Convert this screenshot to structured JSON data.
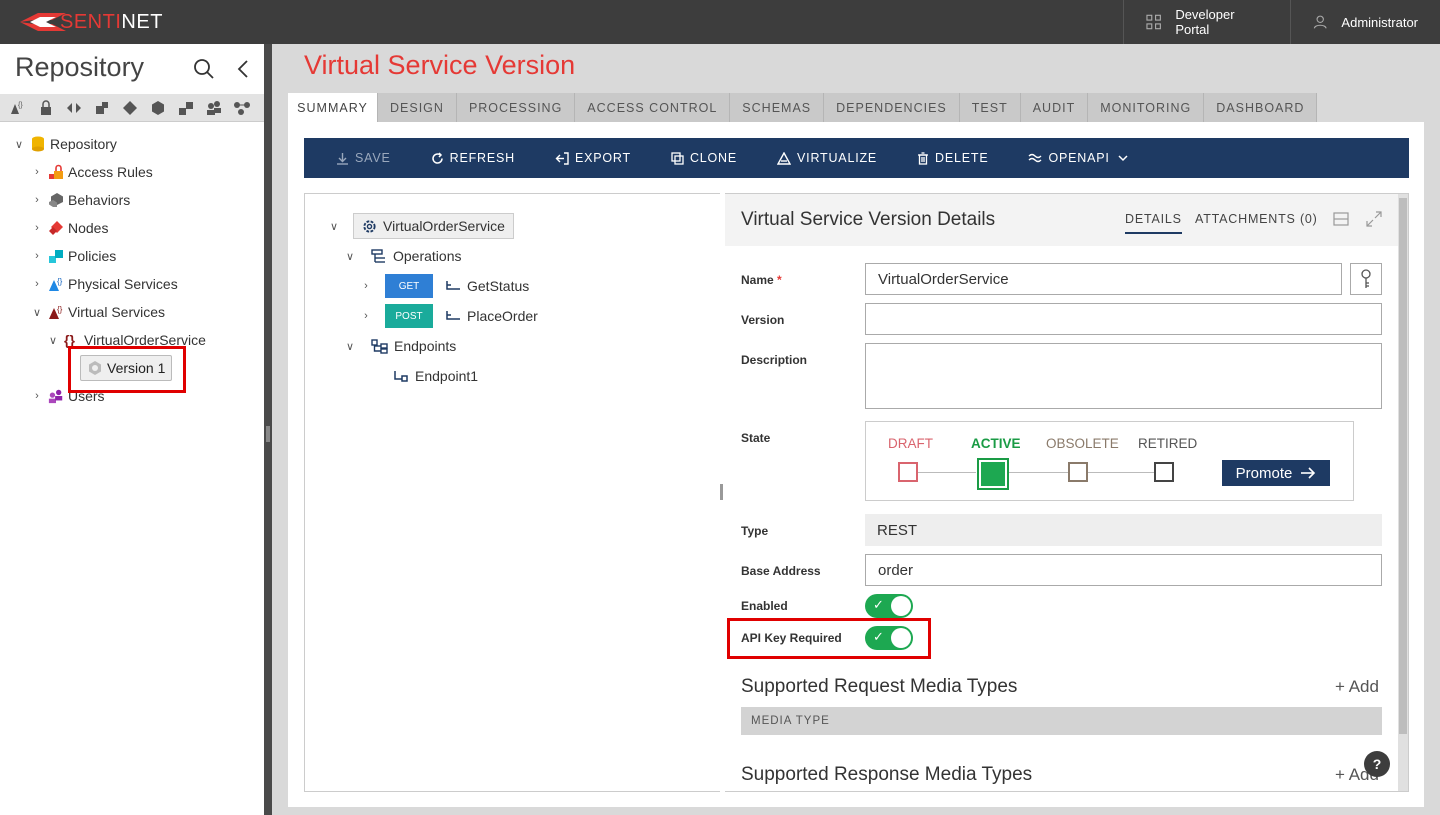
{
  "app": {
    "logo_prefix": "SENTI",
    "logo_suffix": "NET",
    "developer_portal": "Developer Portal",
    "user": "Administrator"
  },
  "sidebar": {
    "title": "Repository",
    "tree": {
      "root": "Repository",
      "items": [
        "Access Rules",
        "Behaviors",
        "Nodes",
        "Policies",
        "Physical Services",
        "Virtual Services"
      ],
      "service": "VirtualOrderService",
      "version": "Version 1",
      "users": "Users"
    }
  },
  "main": {
    "title": "Virtual Service Version",
    "tabs": [
      "SUMMARY",
      "DESIGN",
      "PROCESSING",
      "ACCESS CONTROL",
      "SCHEMAS",
      "DEPENDENCIES",
      "TEST",
      "AUDIT",
      "MONITORING",
      "DASHBOARD"
    ],
    "active_tab": "SUMMARY",
    "toolbar": {
      "save": "SAVE",
      "refresh": "REFRESH",
      "export": "EXPORT",
      "clone": "CLONE",
      "virtualize": "VIRTUALIZE",
      "delete": "DELETE",
      "openapi": "OPENAPI"
    },
    "tree": {
      "root": "VirtualOrderService",
      "operations": "Operations",
      "ops": [
        {
          "verb": "GET",
          "name": "GetStatus"
        },
        {
          "verb": "POST",
          "name": "PlaceOrder"
        }
      ],
      "endpoints": "Endpoints",
      "endpoint": "Endpoint1"
    }
  },
  "details": {
    "title": "Virtual Service Version Details",
    "tab_details": "DETAILS",
    "tab_attachments": "ATTACHMENTS (0)",
    "labels": {
      "name": "Name",
      "version": "Version",
      "description": "Description",
      "state": "State",
      "type": "Type",
      "base_address": "Base Address",
      "enabled": "Enabled",
      "api_key": "API Key Required"
    },
    "required_mark": "*",
    "values": {
      "name": "VirtualOrderService",
      "version": "",
      "description": "",
      "type": "REST",
      "base_address": "order",
      "enabled": true,
      "api_key_required": true
    },
    "states": [
      "DRAFT",
      "ACTIVE",
      "OBSOLETE",
      "RETIRED"
    ],
    "current_state": "ACTIVE",
    "promote": "Promote",
    "req_media_title": "Supported Request Media Types",
    "resp_media_title": "Supported Response Media Types",
    "add": "+ Add",
    "media_type_col": "MEDIA TYPE",
    "help": "?"
  },
  "colors": {
    "accent_red": "#e53935",
    "navy": "#1e3a63",
    "toggle_green": "#1da851",
    "highlight": "#e00000"
  }
}
